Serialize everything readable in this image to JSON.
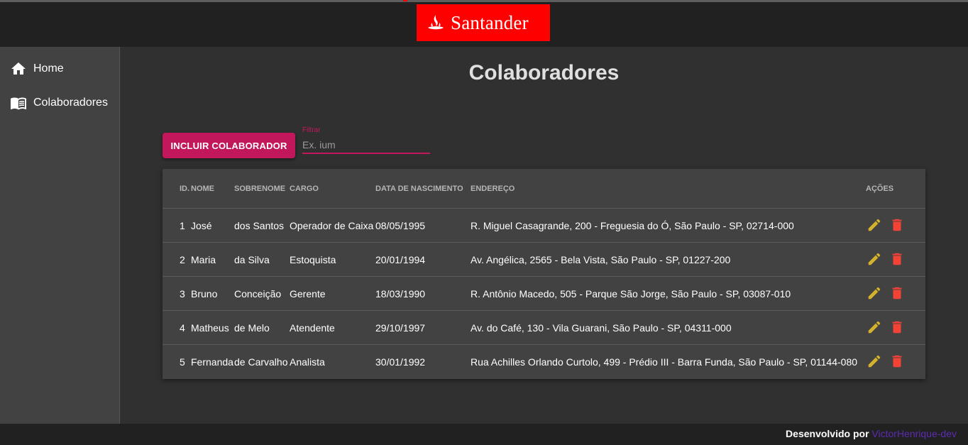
{
  "header": {
    "brand": "Santander"
  },
  "sidebar": {
    "items": [
      {
        "label": "Home",
        "icon": "home-icon"
      },
      {
        "label": "Colaboradores",
        "icon": "book-icon"
      }
    ]
  },
  "main": {
    "title": "Colaboradores",
    "add_button": "INCLUIR COLABORADOR",
    "filter": {
      "label": "Filtrar",
      "placeholder": "Ex. ium"
    }
  },
  "table": {
    "headers": {
      "id": "ID.",
      "nome": "NOME",
      "sobrenome": "SOBRENOME",
      "cargo": "CARGO",
      "nascimento": "DATA DE NASCIMENTO",
      "endereco": "ENDEREÇO",
      "acoes": "AÇÕES"
    },
    "rows": [
      {
        "id": "1",
        "nome": "José",
        "sobrenome": "dos Santos",
        "cargo": "Operador de Caixa",
        "nascimento": "08/05/1995",
        "endereco": "R. Miguel Casagrande, 200 - Freguesia do Ó, São Paulo - SP, 02714-000"
      },
      {
        "id": "2",
        "nome": "Maria",
        "sobrenome": "da Silva",
        "cargo": "Estoquista",
        "nascimento": "20/01/1994",
        "endereco": "Av. Angélica, 2565 - Bela Vista, São Paulo - SP, 01227-200"
      },
      {
        "id": "3",
        "nome": "Bruno",
        "sobrenome": "Conceição",
        "cargo": "Gerente",
        "nascimento": "18/03/1990",
        "endereco": "R. Antônio Macedo, 505 - Parque São Jorge, São Paulo - SP, 03087-010"
      },
      {
        "id": "4",
        "nome": "Matheus",
        "sobrenome": "de Melo",
        "cargo": "Atendente",
        "nascimento": "29/10/1997",
        "endereco": "Av. do Café, 130 - Vila Guarani, São Paulo - SP, 04311-000"
      },
      {
        "id": "5",
        "nome": "Fernanda",
        "sobrenome": "de Carvalho",
        "cargo": "Analista",
        "nascimento": "30/01/1992",
        "endereco": "Rua Achilles Orlando Curtolo, 499 - Prédio III - Barra Funda, São Paulo - SP, 01144-080"
      }
    ]
  },
  "footer": {
    "text": "Desenvolvido por",
    "link": "VictorHenrique-dev"
  },
  "colors": {
    "primary": "#c2185b",
    "brand": "#ff0000",
    "edit_icon": "#d4b32a",
    "delete_icon": "#f44336",
    "footer_link": "#5c2bb0"
  }
}
